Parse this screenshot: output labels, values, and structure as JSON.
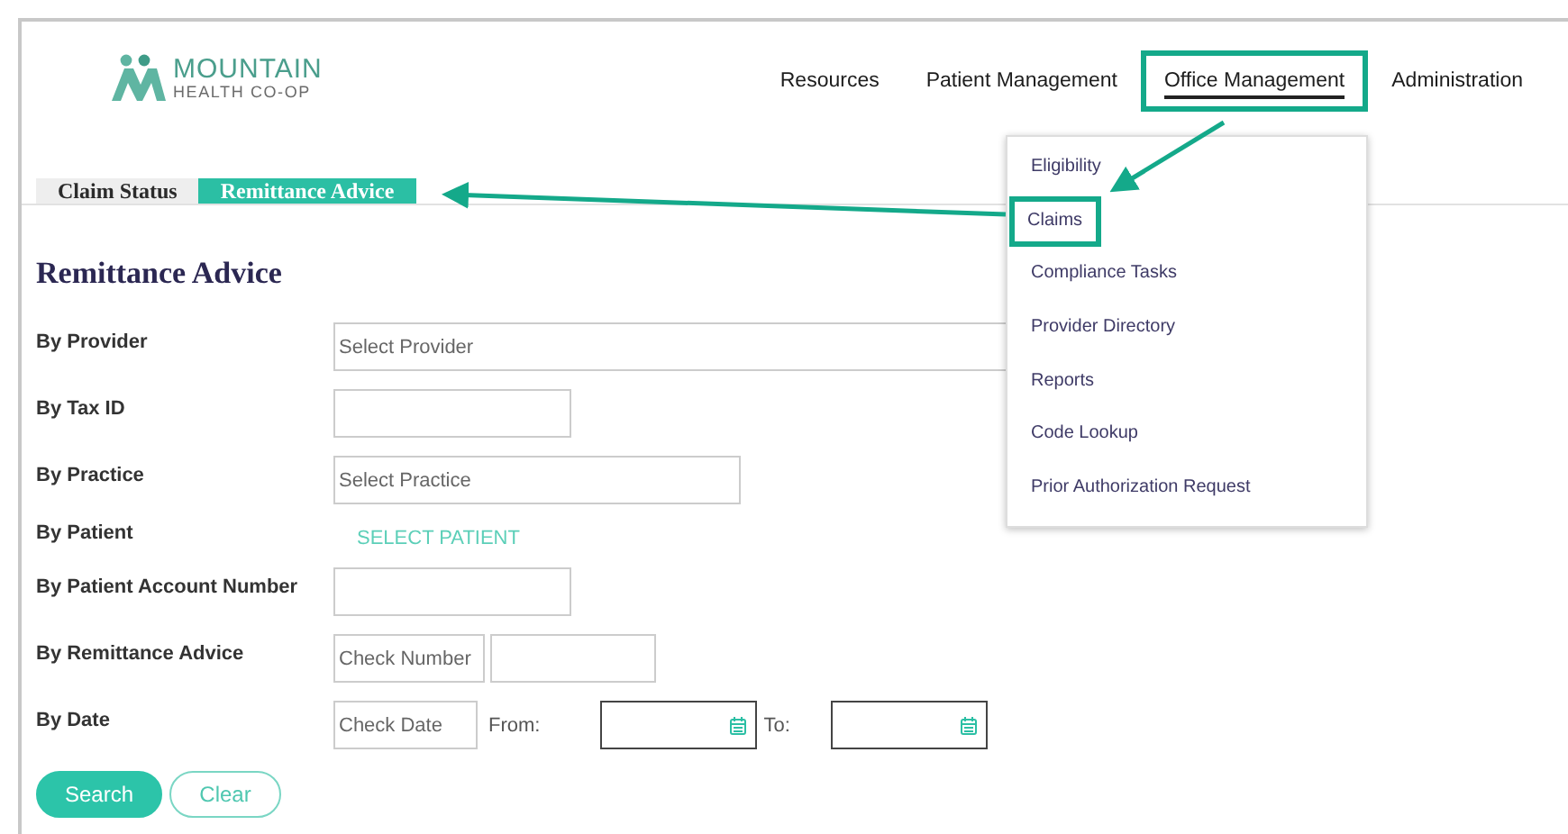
{
  "logo": {
    "name": "MOUNTAIN",
    "tagline": "HEALTH CO-OP"
  },
  "nav": [
    {
      "label": "Resources",
      "selected": false,
      "highlighted": false
    },
    {
      "label": "Patient Management",
      "selected": false,
      "highlighted": false
    },
    {
      "label": "Office Management",
      "selected": true,
      "highlighted": true
    },
    {
      "label": "Administration",
      "selected": false,
      "highlighted": false
    }
  ],
  "menu": [
    {
      "label": "Eligibility",
      "highlighted": false
    },
    {
      "label": "Claims",
      "highlighted": true
    },
    {
      "label": "Compliance Tasks",
      "highlighted": false
    },
    {
      "label": "Provider Directory",
      "highlighted": false
    },
    {
      "label": "Reports",
      "highlighted": false
    },
    {
      "label": "Code Lookup",
      "highlighted": false
    },
    {
      "label": "Prior Authorization Request",
      "highlighted": false
    }
  ],
  "tabs": [
    {
      "label": "Claim Status",
      "selected": false
    },
    {
      "label": "Remittance Advice",
      "selected": true
    }
  ],
  "heading": "Remittance Advice",
  "rows": [
    {
      "label": "By Provider",
      "kind": "select",
      "placeholder": "Select Provider"
    },
    {
      "label": "By Tax ID",
      "kind": "text"
    },
    {
      "label": "By Practice",
      "kind": "select",
      "placeholder": "Select Practice"
    },
    {
      "label": "By Patient",
      "kind": "link",
      "link": "SELECT PATIENT"
    },
    {
      "label": "By Patient Account Number",
      "kind": "text"
    },
    {
      "label": "By Remittance Advice",
      "kind": "pair",
      "placeholder": "Check Number"
    },
    {
      "label": "By Date",
      "kind": "daterange",
      "placeholder": "Check Date",
      "from_label": "From:",
      "to_label": "To:"
    }
  ],
  "buttons": [
    {
      "label": "Search",
      "kind": "primary"
    },
    {
      "label": "Clear",
      "kind": "secondary"
    }
  ]
}
